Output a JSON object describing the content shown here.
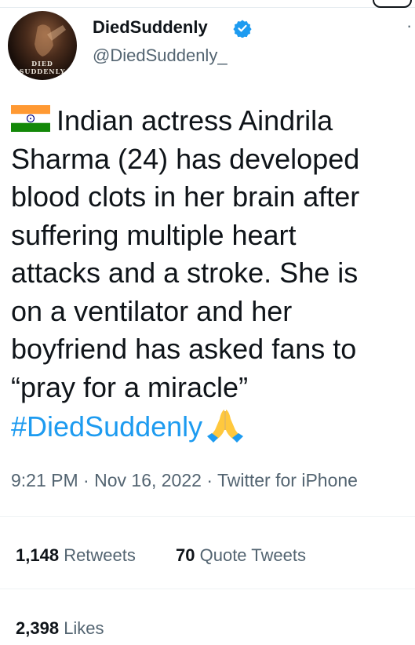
{
  "author": {
    "display_name": "DiedSuddenly",
    "handle": "@DiedSuddenly_",
    "verified": true,
    "avatar_text": "DIED SUDDENLY"
  },
  "tweet": {
    "flag_icon": "india-flag-icon",
    "text": "Indian actress Aindrila\nSharma (24) has developed\nblood clots in her brain after\nsuffering multiple heart\nattacks and a stroke. She is\non a ventilator and her\nboyfriend has asked fans to\n“pray for a miracle”\n",
    "hashtag": "#DiedSuddenly",
    "end_emoji": "folded-hands-icon",
    "time": "9:21 PM",
    "date": "Nov 16, 2022",
    "source": "Twitter for iPhone",
    "meta_sep": "·"
  },
  "stats": {
    "retweets_count": "1,148",
    "retweets_label": "Retweets",
    "quotes_count": "70",
    "quotes_label": "Quote Tweets",
    "likes_count": "2,398",
    "likes_label": "Likes"
  },
  "colors": {
    "accent": "#1d9bf0",
    "secondary_text": "#536471",
    "primary_text": "#0f1419"
  }
}
